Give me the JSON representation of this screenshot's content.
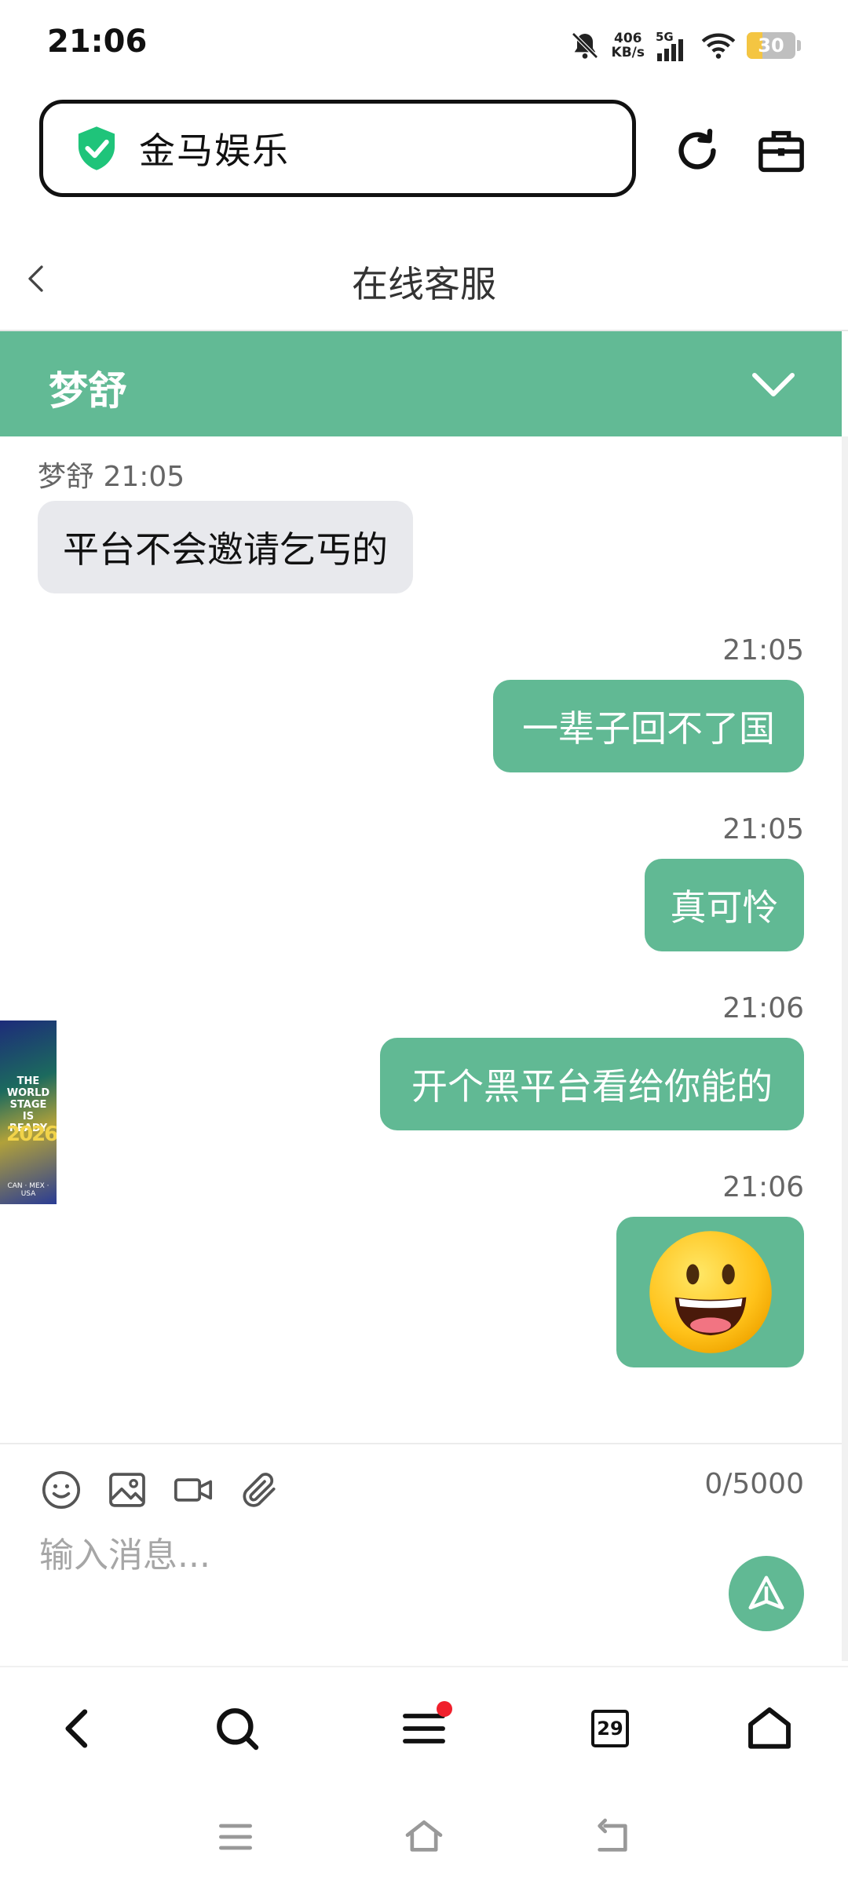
{
  "status_bar": {
    "time": "21:06",
    "speed_value": "406",
    "speed_unit": "KB/s",
    "network": "5G",
    "battery": "30",
    "battery_level": 0.3,
    "icons": [
      "bell-muted-icon",
      "signal-icon",
      "wifi-icon",
      "battery-icon"
    ]
  },
  "browser": {
    "site_title": "金马娱乐",
    "icons": [
      "shield-check-icon",
      "reload-icon",
      "toolbox-icon"
    ]
  },
  "page": {
    "title": "在线客服"
  },
  "agent": {
    "name": "梦舒"
  },
  "messages": [
    {
      "direction": "in",
      "sender": "梦舒",
      "time": "21:05",
      "text": "平台不会邀请乞丐的"
    },
    {
      "direction": "out",
      "time": "21:05",
      "text": "一辈子回不了国"
    },
    {
      "direction": "out",
      "time": "21:05",
      "text": "真可怜"
    },
    {
      "direction": "out",
      "time": "21:06",
      "text": "开个黑平台看给你能的"
    },
    {
      "direction": "out",
      "time": "21:06",
      "text": "",
      "emoji": "grinning-face"
    }
  ],
  "side_ad": {
    "line1": "THE WORLD STAGE IS READY",
    "year": "2026",
    "footer": "CAN · MEX · USA"
  },
  "composer": {
    "counter": "0/5000",
    "placeholder": "输入消息...",
    "toolbar_icons": [
      "emoji-icon",
      "image-icon",
      "video-icon",
      "attachment-icon"
    ]
  },
  "bottom_nav": {
    "tabs_count": "29",
    "icons": [
      "back-icon",
      "search-icon",
      "menu-icon",
      "tabs-icon",
      "home-icon"
    ]
  },
  "colors": {
    "accent": "#61b994",
    "incoming_bubble": "#e8e9ed",
    "notification_dot": "#f0202c"
  }
}
